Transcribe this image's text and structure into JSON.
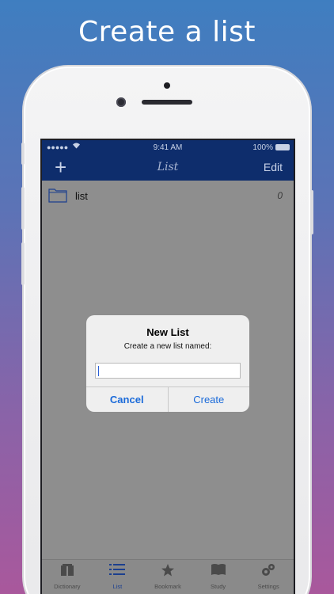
{
  "headline": "Create a list",
  "status_bar": {
    "signal": "●●●●●",
    "time": "9:41 AM",
    "battery": "100%"
  },
  "nav": {
    "add_label": "+",
    "title": "List",
    "edit_label": "Edit"
  },
  "list_items": [
    {
      "label": "list",
      "count": "0",
      "icon": "folder-icon"
    }
  ],
  "dialog": {
    "title": "New List",
    "message": "Create a new list named:",
    "input_value": "",
    "input_placeholder": "",
    "cancel_label": "Cancel",
    "create_label": "Create"
  },
  "tabs": [
    {
      "label": "Dictionary",
      "icon": "dictionary-icon",
      "active": false
    },
    {
      "label": "List",
      "icon": "list-icon",
      "active": true
    },
    {
      "label": "Bookmark",
      "icon": "star-icon",
      "active": false
    },
    {
      "label": "Study",
      "icon": "book-icon",
      "active": false
    },
    {
      "label": "Settings",
      "icon": "gears-icon",
      "active": false
    }
  ],
  "colors": {
    "nav_background": "#0e2d6c",
    "accent_blue": "#1a6ad9",
    "active_tab": "#1b3f8f"
  }
}
